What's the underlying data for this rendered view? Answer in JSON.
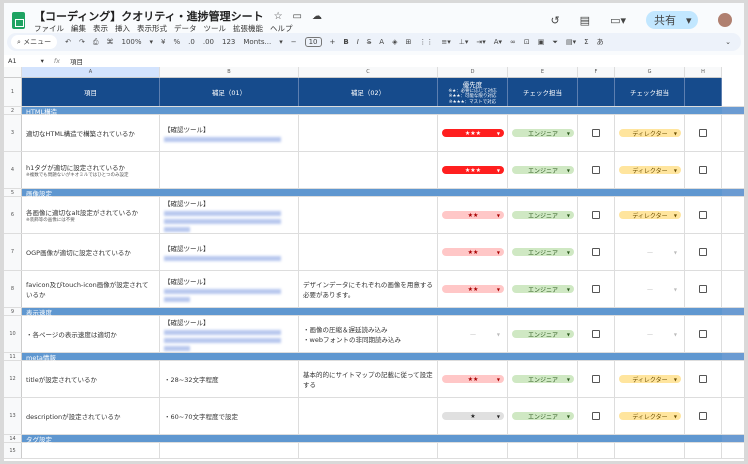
{
  "app": {
    "title": "【コーディング】クオリティ・進捗管理シート",
    "menu": [
      "ファイル",
      "編集",
      "表示",
      "挿入",
      "表示形式",
      "データ",
      "ツール",
      "拡張機能",
      "ヘルプ"
    ],
    "share_label": "共有"
  },
  "toolbar": {
    "search": "メニュー",
    "zoom": "100%",
    "currency": "¥",
    "percent": "%",
    "dec_less": ".0",
    "dec_more": ".00",
    "format123": "123",
    "font": "Monts...",
    "font_size": "10",
    "bold": "B",
    "italic": "I",
    "sigma": "Σ",
    "input": "あ"
  },
  "formula": {
    "cell": "A1",
    "fx": "fx",
    "value": "項目"
  },
  "columns": [
    "A",
    "B",
    "C",
    "D",
    "E",
    "F",
    "G",
    "H"
  ],
  "header": {
    "a": "項目",
    "b": "補足（01）",
    "c": "補足（02）",
    "d_title": "優先度",
    "d_lines": [
      "※★：必要に応じて対応",
      "※★★：可能な限り対応",
      "※★★★：マストで対応"
    ],
    "e": "チェック担当",
    "g": "チェック担当"
  },
  "colors": {
    "header": "#164b8c",
    "section": "#5f97d0",
    "star3": "#ff1f1f",
    "star2": "#ffc7c7",
    "star1": "#e0e0e0",
    "engineer": "#cfe8c3",
    "director": "#ffe59e"
  },
  "rows": [
    {
      "n": "1",
      "type": "header"
    },
    {
      "n": "2",
      "type": "section",
      "label": "HTML構造"
    },
    {
      "n": "3",
      "type": "item",
      "a": "適切なHTML構造で構築されているか",
      "b": "【確認ツール】",
      "url": 1,
      "c": "",
      "prio": "★★★",
      "lvl": 3,
      "e": "エンジニア",
      "g": "ディレクター"
    },
    {
      "n": "4",
      "type": "item",
      "a": "h1タグが適切に設定されているか",
      "note": "※複数でも問題ないがキオミルではひとつのみ設定",
      "b": "",
      "c": "",
      "prio": "★★★",
      "lvl": 3,
      "e": "エンジニア",
      "g": "ディレクター"
    },
    {
      "n": "5",
      "type": "section",
      "label": "画像設定"
    },
    {
      "n": "6",
      "type": "item",
      "a": "各画像に適切なalt設定がされているか",
      "note": "※装飾等の画像には不要",
      "b": "【確認ツール】",
      "url": 3,
      "c": "",
      "prio": "★★",
      "lvl": 2,
      "e": "エンジニア",
      "g": "ディレクター"
    },
    {
      "n": "7",
      "type": "item",
      "a": "OGP画像が適切に設定されているか",
      "b": "【確認ツール】",
      "url": 1,
      "c": "",
      "prio": "★★",
      "lvl": 2,
      "e": "エンジニア",
      "g": "—"
    },
    {
      "n": "8",
      "type": "item",
      "a": "favicon及びtouch-icon画像が設定されているか",
      "b": "【確認ツール】",
      "url": 2,
      "c": "デザインデータにそれぞれの画像を用意する必要があります。",
      "prio": "★★",
      "lvl": 2,
      "e": "エンジニア",
      "g": "—"
    },
    {
      "n": "9",
      "type": "section",
      "label": "表示速度"
    },
    {
      "n": "10",
      "type": "item",
      "a": "・各ページの表示速度は適切か",
      "b": "【確認ツール】",
      "url": 3,
      "c": "・画像の圧縮＆遅延読み込み\n・webフォントの非同期読み込み",
      "prio": "—",
      "lvl": 0,
      "e": "エンジニア",
      "g": "—"
    },
    {
      "n": "11",
      "type": "section",
      "label": "meta情報"
    },
    {
      "n": "12",
      "type": "item",
      "a": "titleが設定されているか",
      "b": "・28~32文字程度",
      "c": "基本的的にサイトマップの記載に従って設定する",
      "prio": "★★",
      "lvl": 2,
      "e": "エンジニア",
      "g": "ディレクター"
    },
    {
      "n": "13",
      "type": "item",
      "a": "descriptionが設定されているか",
      "b": "・60~70文字程度で設定",
      "c": "",
      "prio": "★",
      "lvl": 1,
      "e": "エンジニア",
      "g": "ディレクター"
    },
    {
      "n": "14",
      "type": "section",
      "label": "タグ設定"
    },
    {
      "n": "15",
      "type": "item",
      "a": "",
      "b": "",
      "c": "",
      "prio": "",
      "lvl": -1,
      "e": "",
      "g": ""
    }
  ]
}
